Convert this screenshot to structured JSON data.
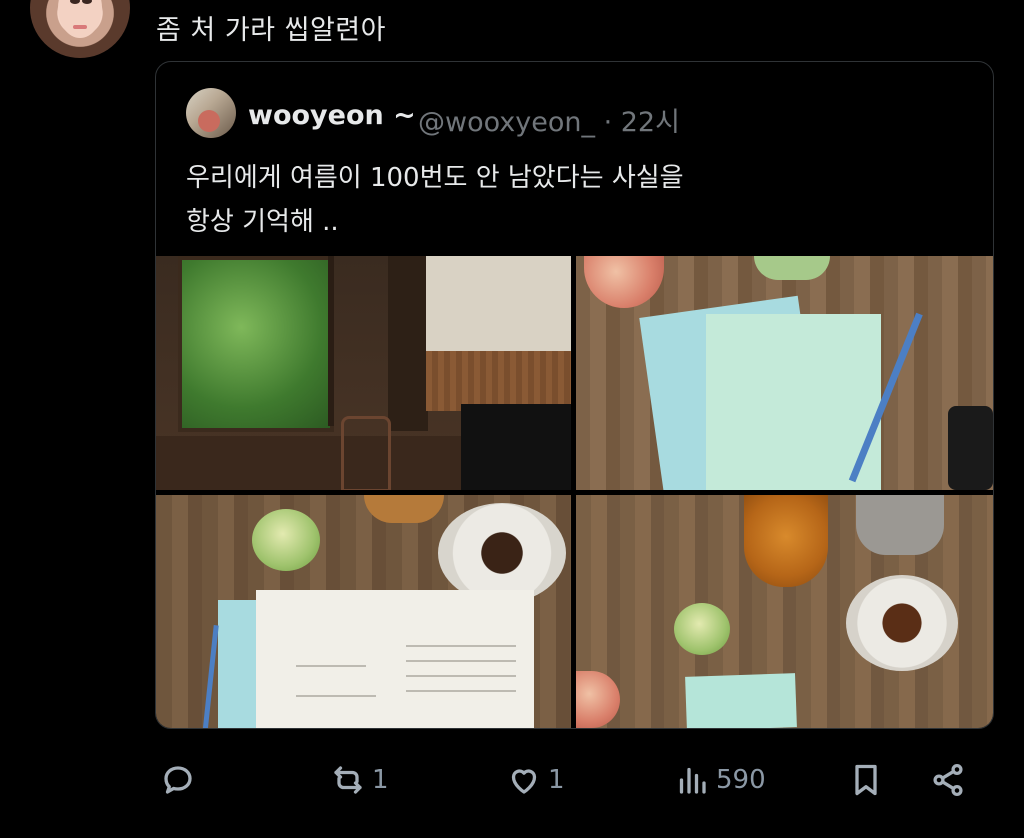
{
  "post": {
    "text": "좀 처 가라 씹알련아"
  },
  "quote": {
    "display_name": "wooyeon ~",
    "handle_time": "@wooxyeon_ · 22시",
    "text": "우리에게 여름이 100번도 안 남았다는 사실을\n항상 기억해 .."
  },
  "photos": [
    {
      "alt": "living room with window and piano"
    },
    {
      "alt": "poetry books and pencil on wooden table"
    },
    {
      "alt": "open book, apple and cup of tea"
    },
    {
      "alt": "tea cup, honey jar, apple and note"
    }
  ],
  "actions": {
    "replies": "",
    "reposts": "1",
    "likes": "1",
    "views": "590"
  },
  "icons": [
    "reply-icon",
    "repost-icon",
    "like-icon",
    "views-icon",
    "bookmark-icon",
    "share-icon"
  ],
  "colors": {
    "background": "#000000",
    "text": "#e7e9ea",
    "muted": "#71767b",
    "icon": "#a4aeb8"
  }
}
